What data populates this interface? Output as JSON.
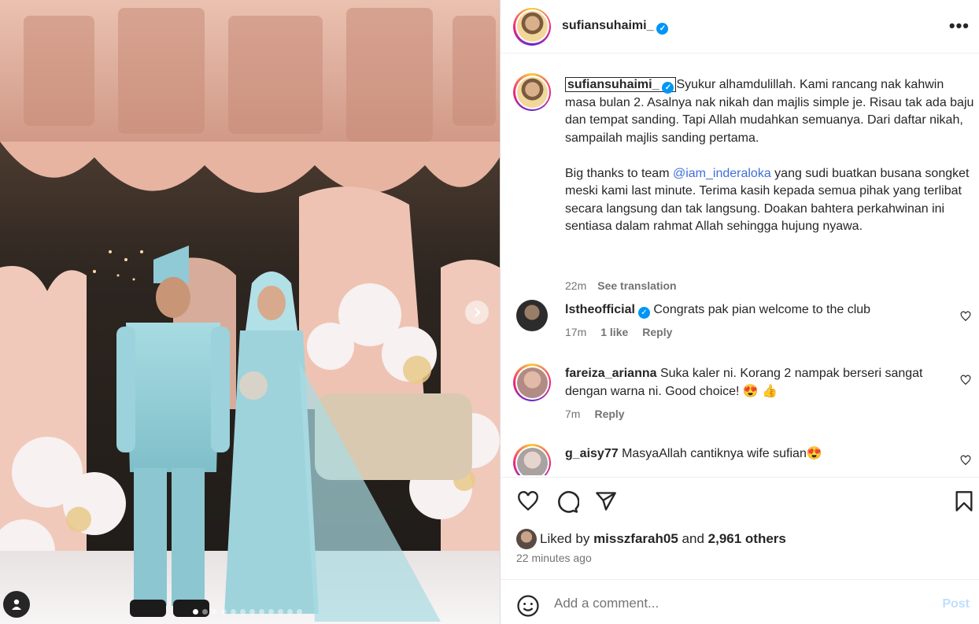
{
  "post": {
    "username": "sufiansuhaimi_",
    "more_icon": "more-horizontal-icon"
  },
  "caption": {
    "username": "sufiansuhaimi_",
    "text1": "Syukur alhamdulillah. Kami rancang nak kahwin masa bulan 2. Asalnya nak nikah dan majlis simple je. Risau tak ada baju dan tempat sanding. Tapi Allah mudahkan semuanya. Dari daftar nikah, sampailah majlis sanding pertama.",
    "text2_before": "Big thanks to team ",
    "mention": "@iam_inderaloka",
    "text2_after": " yang sudi buatkan busana songket meski kami last minute. Terima kasih kepada semua pihak yang terlibat secara langsung dan tak langsung. Doakan bahtera perkahwinan ini sentiasa dalam rahmat Allah sehingga hujung nyawa.",
    "time": "22m",
    "see_translation": "See translation"
  },
  "comments": [
    {
      "user": "lstheofficial",
      "verified": true,
      "text": "Congrats pak pian welcome to the club",
      "time": "17m",
      "likes": "1 like",
      "reply": "Reply"
    },
    {
      "user": "fareiza_arianna",
      "verified": false,
      "text": "Suka kaler ni. Korang 2 nampak berseri sangat dengan warna ni. Good choice! 😍 👍",
      "time": "7m",
      "reply": "Reply"
    },
    {
      "user": "g_aisy77",
      "verified": false,
      "text": "MasyaAllah cantiknya wife sufian😍"
    }
  ],
  "likes": {
    "prefix": "Liked by ",
    "user": "misszfarah05",
    "middle": " and ",
    "count": "2,961 others"
  },
  "timestamp": "22 minutes ago",
  "add_comment": {
    "placeholder": "Add a comment...",
    "post_label": "Post"
  },
  "carousel": {
    "slides": 12,
    "active_index": 0
  },
  "colors": {
    "verified": "#0095f6",
    "link": "#3f6fd8",
    "muted": "#737373",
    "post_disabled": "#c0dffd"
  }
}
